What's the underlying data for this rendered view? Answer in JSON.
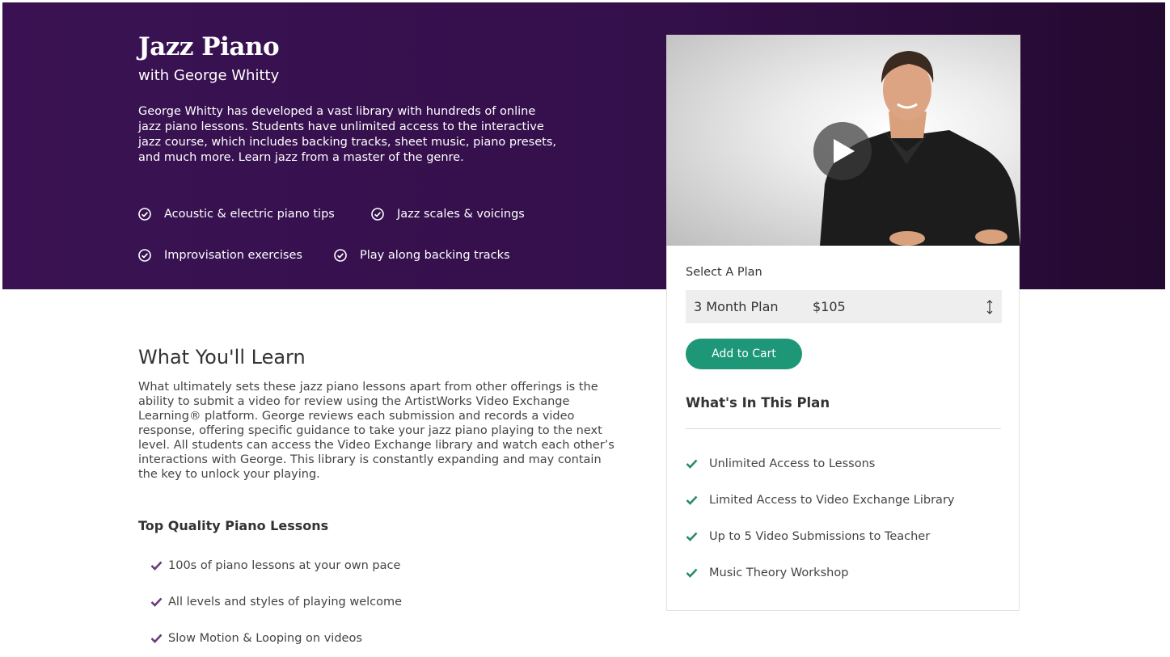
{
  "hero": {
    "title": "Jazz Piano",
    "subtitle": "with George Whitty",
    "description": "George Whitty has developed a vast library with hundreds of online jazz piano lessons. Students have unlimited access to the interactive jazz course, which includes backing tracks, sheet music, piano presets, and much more. Learn jazz from a master of the genre.",
    "features": [
      {
        "label": "Acoustic & electric piano tips",
        "icon": "check-circle-icon"
      },
      {
        "label": "Jazz scales & voicings",
        "icon": "check-circle-icon"
      },
      {
        "label": "Improvisation exercises",
        "icon": "check-circle-icon"
      },
      {
        "label": "Play along backing tracks",
        "icon": "check-circle-icon"
      }
    ],
    "colors": {
      "background": "#34104b",
      "text": "#ffffff"
    }
  },
  "video": {
    "icon": "play-icon"
  },
  "plan": {
    "select_label": "Select A Plan",
    "selected_plan": "3 Month Plan",
    "selected_price": "$105",
    "select_icon": "up-down-arrow-icon",
    "add_to_cart_label": "Add to Cart",
    "heading": "What's In This Plan",
    "items": [
      "Unlimited Access to Lessons",
      "Limited Access to Video Exchange Library",
      "Up to 5 Video Submissions to Teacher",
      "Music Theory Workshop"
    ],
    "colors": {
      "button": "#1e9779",
      "check": "#2a8a6a"
    }
  },
  "learn": {
    "title": "What You'll Learn",
    "description": "What ultimately sets these jazz piano lessons apart from other offerings is the ability to submit a video for review using the ArtistWorks Video Exchange Learning® platform. George reviews each submission and records a video response, offering specific guidance to take your jazz piano playing to the next level. All students can access the Video Exchange library and watch each other’s interactions with George. This library is constantly expanding and may contain the key to unlock your playing.",
    "quality_title": "Top Quality Piano Lessons",
    "quality_items": [
      "100s of piano lessons at your own pace",
      "All levels and styles of playing welcome",
      "Slow Motion & Looping on videos"
    ],
    "colors": {
      "check": "#6b3a7d"
    }
  }
}
